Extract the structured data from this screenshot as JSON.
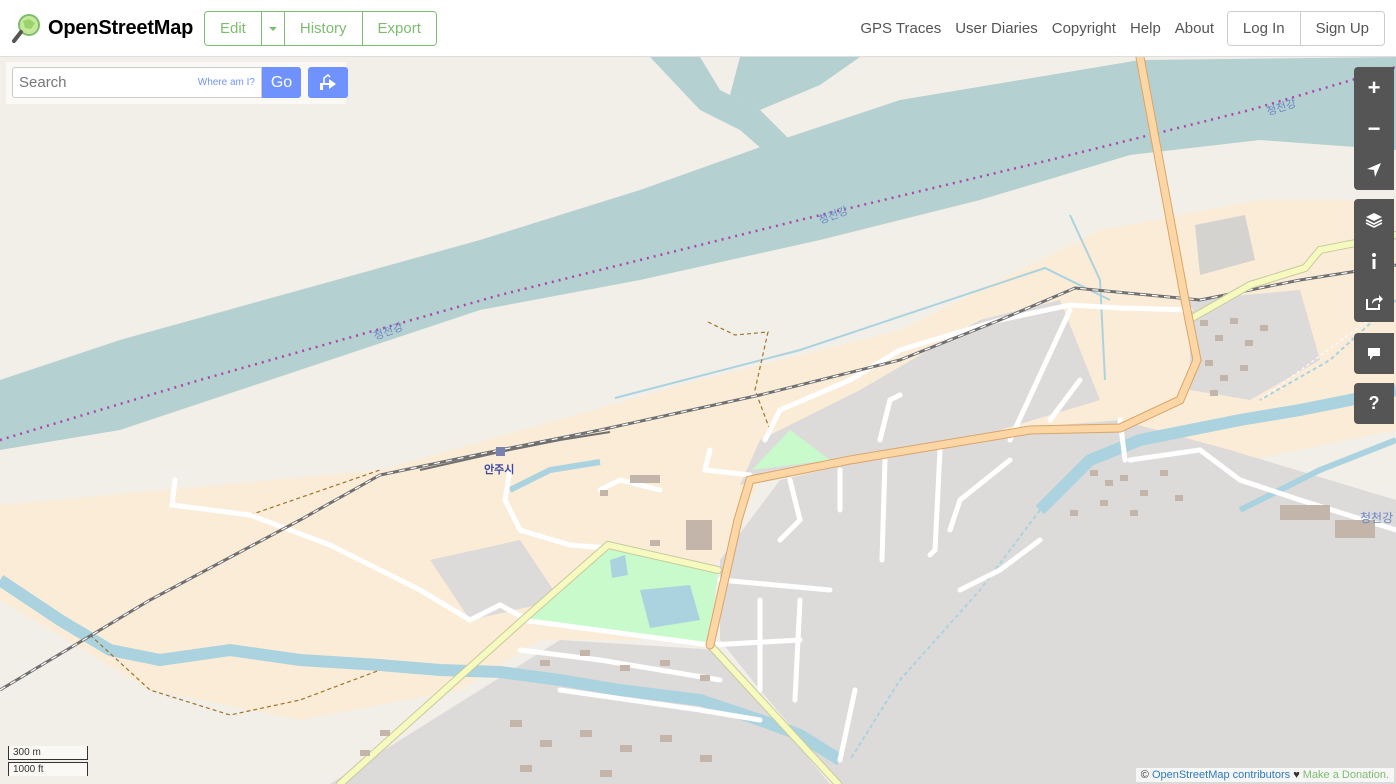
{
  "header": {
    "site_title": "OpenStreetMap",
    "edit_label": "Edit",
    "history_label": "History",
    "export_label": "Export",
    "nav": [
      "GPS Traces",
      "User Diaries",
      "Copyright",
      "Help",
      "About"
    ],
    "login_label": "Log In",
    "signup_label": "Sign Up"
  },
  "search": {
    "placeholder": "Search",
    "where_am_i": "Where am I?",
    "go_label": "Go",
    "directions_icon": "directions-icon"
  },
  "map_controls": {
    "zoom_in": "+",
    "zoom_out": "−",
    "geolocate_icon": "location-arrow-icon",
    "layers_icon": "layers-icon",
    "info_icon": "info-icon",
    "share_icon": "share-icon",
    "note_icon": "note-icon",
    "query_label": "?"
  },
  "map_labels": {
    "river_1": "청천강",
    "river_2": "청천강",
    "river_3": "청천강",
    "river_4": "청천강",
    "station": "안주시"
  },
  "scale": {
    "metric": "300 m",
    "imperial": "1000 ft"
  },
  "attribution": {
    "prefix": "©",
    "contributors": "OpenStreetMap contributors",
    "heart": "♥",
    "donation": "Make a Donation."
  },
  "colors": {
    "brand_green": "#7ebc6f",
    "search_blue": "#7092ff",
    "water": "#aad3df",
    "river_wide": "#b5d0d0",
    "land": "#f2efe9",
    "farmland": "#fbecd7",
    "residential": "#dddada",
    "park": "#c8facc",
    "primary_road": "#fcd6a4",
    "secondary_road": "#f7fabf",
    "boundary": "#ac46ac"
  }
}
